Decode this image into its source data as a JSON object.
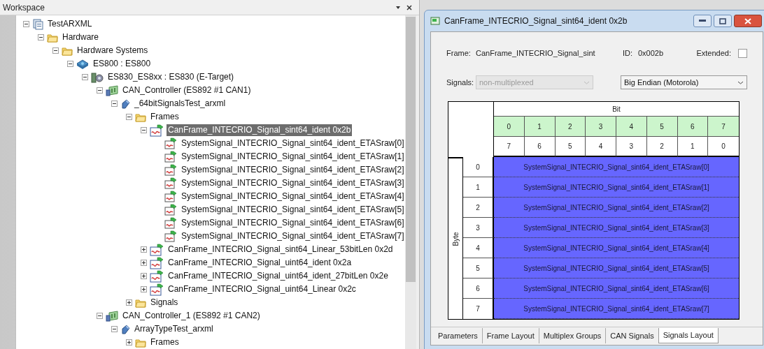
{
  "workspace": {
    "title": "Workspace",
    "tree": [
      {
        "label": "TestARXML",
        "kind": "project",
        "expanded": true,
        "selected": false,
        "children": [
          {
            "label": "Hardware",
            "kind": "folder",
            "expanded": true,
            "selected": false,
            "children": [
              {
                "label": "Hardware Systems",
                "kind": "folder",
                "expanded": true,
                "selected": false,
                "children": [
                  {
                    "label": "ES800 : ES800",
                    "kind": "network",
                    "expanded": true,
                    "selected": false,
                    "children": [
                      {
                        "label": "ES830_ES8xx : ES830 (E-Target)",
                        "kind": "module",
                        "expanded": true,
                        "selected": false,
                        "children": [
                          {
                            "label": "CAN_Controller (ES892 #1 CAN1)",
                            "kind": "card",
                            "expanded": true,
                            "selected": false,
                            "children": [
                              {
                                "label": "_64bitSignalsTest_arxml",
                                "kind": "file",
                                "expanded": true,
                                "selected": false,
                                "children": [
                                  {
                                    "label": "Frames",
                                    "kind": "folder",
                                    "expanded": true,
                                    "selected": false,
                                    "children": [
                                      {
                                        "label": "CanFrame_INTECRIO_Signal_sint64_ident 0x2b",
                                        "kind": "frame",
                                        "expanded": true,
                                        "selected": true,
                                        "children": [
                                          {
                                            "label": "SystemSignal_INTECRIO_Signal_sint64_ident_ETASraw[0]",
                                            "kind": "signal",
                                            "selected": false
                                          },
                                          {
                                            "label": "SystemSignal_INTECRIO_Signal_sint64_ident_ETASraw[1]",
                                            "kind": "signal",
                                            "selected": false
                                          },
                                          {
                                            "label": "SystemSignal_INTECRIO_Signal_sint64_ident_ETASraw[2]",
                                            "kind": "signal",
                                            "selected": false
                                          },
                                          {
                                            "label": "SystemSignal_INTECRIO_Signal_sint64_ident_ETASraw[3]",
                                            "kind": "signal",
                                            "selected": false
                                          },
                                          {
                                            "label": "SystemSignal_INTECRIO_Signal_sint64_ident_ETASraw[4]",
                                            "kind": "signal",
                                            "selected": false
                                          },
                                          {
                                            "label": "SystemSignal_INTECRIO_Signal_sint64_ident_ETASraw[5]",
                                            "kind": "signal",
                                            "selected": false
                                          },
                                          {
                                            "label": "SystemSignal_INTECRIO_Signal_sint64_ident_ETASraw[6]",
                                            "kind": "signal",
                                            "selected": false
                                          },
                                          {
                                            "label": "SystemSignal_INTECRIO_Signal_sint64_ident_ETASraw[7]",
                                            "kind": "signal",
                                            "selected": false
                                          }
                                        ]
                                      },
                                      {
                                        "label": "CanFrame_INTECRIO_Signal_sint64_Linear_53bitLen 0x2d",
                                        "kind": "frame",
                                        "expanded": false,
                                        "selected": false
                                      },
                                      {
                                        "label": "CanFrame_INTECRIO_Signal_uint64_ident 0x2a",
                                        "kind": "frame",
                                        "expanded": false,
                                        "selected": false
                                      },
                                      {
                                        "label": "CanFrame_INTECRIO_Signal_uint64_ident_27bitLen 0x2e",
                                        "kind": "frame",
                                        "expanded": false,
                                        "selected": false
                                      },
                                      {
                                        "label": "CanFrame_INTECRIO_Signal_uint64_Linear 0x2c",
                                        "kind": "frame",
                                        "expanded": false,
                                        "selected": false
                                      }
                                    ]
                                  },
                                  {
                                    "label": "Signals",
                                    "kind": "folder",
                                    "expanded": false,
                                    "selected": false
                                  }
                                ]
                              }
                            ]
                          },
                          {
                            "label": "CAN_Controller_1 (ES892 #1 CAN2)",
                            "kind": "card",
                            "expanded": true,
                            "selected": false,
                            "children": [
                              {
                                "label": "ArrayTypeTest_arxml",
                                "kind": "file",
                                "expanded": true,
                                "selected": false,
                                "children": [
                                  {
                                    "label": "Frames",
                                    "kind": "folder",
                                    "expanded": false,
                                    "selected": false
                                  }
                                ]
                              }
                            ]
                          }
                        ]
                      }
                    ]
                  }
                ]
              }
            ]
          }
        ]
      }
    ]
  },
  "editor": {
    "title": "CanFrame_INTECRIO_Signal_sint64_ident 0x2b",
    "frame_label": "Frame:",
    "frame_value": "CanFrame_INTECRIO_Signal_sint",
    "id_label": "ID:",
    "id_value": "0x002b",
    "extended_label": "Extended:",
    "extended_checked": false,
    "signals_label": "Signals:",
    "signals_select": {
      "value": "non-multiplexed",
      "disabled": true
    },
    "byte_order_select": {
      "value": "Big Endian (Motorola)",
      "disabled": false
    },
    "layout": {
      "bit_header": "Bit",
      "byte_header": "Byte",
      "bit_numbers": [
        "0",
        "1",
        "2",
        "3",
        "4",
        "5",
        "6",
        "7"
      ],
      "bit_numbers_reversed": [
        "7",
        "6",
        "5",
        "4",
        "3",
        "2",
        "1",
        "0"
      ],
      "rows": [
        {
          "byte": "0",
          "signal": "SystemSignal_INTECRIO_Signal_sint64_ident_ETASraw[0]"
        },
        {
          "byte": "1",
          "signal": "SystemSignal_INTECRIO_Signal_sint64_ident_ETASraw[1]"
        },
        {
          "byte": "2",
          "signal": "SystemSignal_INTECRIO_Signal_sint64_ident_ETASraw[2]"
        },
        {
          "byte": "3",
          "signal": "SystemSignal_INTECRIO_Signal_sint64_ident_ETASraw[3]"
        },
        {
          "byte": "4",
          "signal": "SystemSignal_INTECRIO_Signal_sint64_ident_ETASraw[4]"
        },
        {
          "byte": "5",
          "signal": "SystemSignal_INTECRIO_Signal_sint64_ident_ETASraw[5]"
        },
        {
          "byte": "6",
          "signal": "SystemSignal_INTECRIO_Signal_sint64_ident_ETASraw[6]"
        },
        {
          "byte": "7",
          "signal": "SystemSignal_INTECRIO_Signal_sint64_ident_ETASraw[7]"
        }
      ]
    },
    "tabs": [
      {
        "label": "Parameters",
        "selected": false
      },
      {
        "label": "Frame Layout",
        "selected": false
      },
      {
        "label": "Multiplex Groups",
        "selected": false
      },
      {
        "label": "CAN Signals",
        "selected": false
      },
      {
        "label": "Signals Layout",
        "selected": true
      }
    ]
  }
}
